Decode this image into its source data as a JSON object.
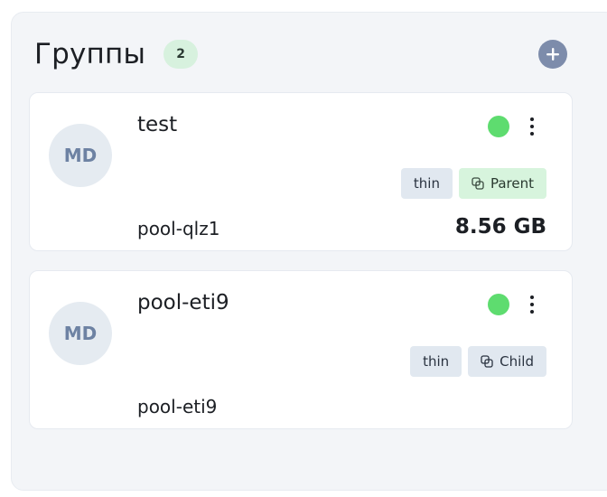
{
  "groups": {
    "title": "Группы",
    "count": "2",
    "add_icon": "plus-circle-icon"
  },
  "cards": [
    {
      "avatar": "MD",
      "name": "test",
      "status_color": "#5edc6f",
      "tags": [
        {
          "label": "thin"
        },
        {
          "label": "Parent",
          "icon": "link-icon"
        }
      ],
      "pool": "pool-qlz1",
      "size": "8.56 GB"
    },
    {
      "avatar": "MD",
      "name": "pool-eti9",
      "status_color": "#5edc6f",
      "tags": [
        {
          "label": "thin"
        },
        {
          "label": "Child",
          "icon": "link-icon"
        }
      ],
      "pool": "pool-eti9",
      "size": ""
    }
  ],
  "colors": {
    "accent": "#7d8cab",
    "status_active": "#5edc6f",
    "badge_bg": "#d7f1de"
  }
}
